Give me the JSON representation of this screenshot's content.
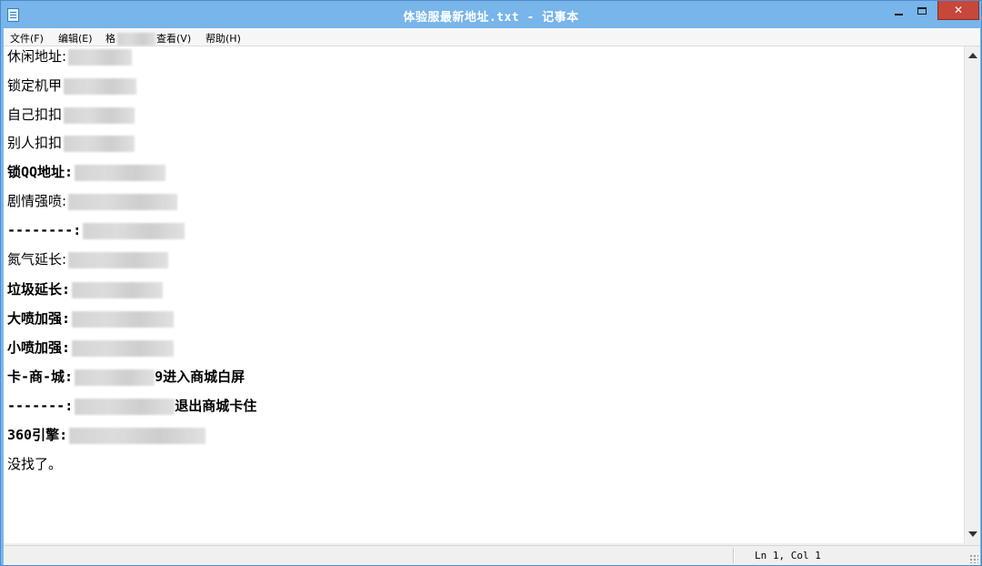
{
  "window": {
    "title": "体验服最新地址.txt - 记事本",
    "close_glyph": "✕"
  },
  "menu": {
    "file": "文件(F)",
    "edit": "编辑(E)",
    "format": "格",
    "view": "查看(V)",
    "help": "帮助(H)"
  },
  "document": {
    "lines": [
      "休闲地址:",
      "锁定机甲",
      "自己扣扣",
      "别人扣扣",
      "锁QQ地址:",
      "剧情强喷:",
      "--------:",
      "氮气延长:",
      "垃圾延长:",
      "大喷加强:",
      "小喷加强:",
      "卡-商-城:",
      "-------:",
      "360引擎:",
      "没找了。"
    ],
    "line_11_tail": "9进入商城白屏",
    "line_12_tail": "退出商城卡住"
  },
  "status": {
    "position": "Ln 1, Col 1"
  }
}
